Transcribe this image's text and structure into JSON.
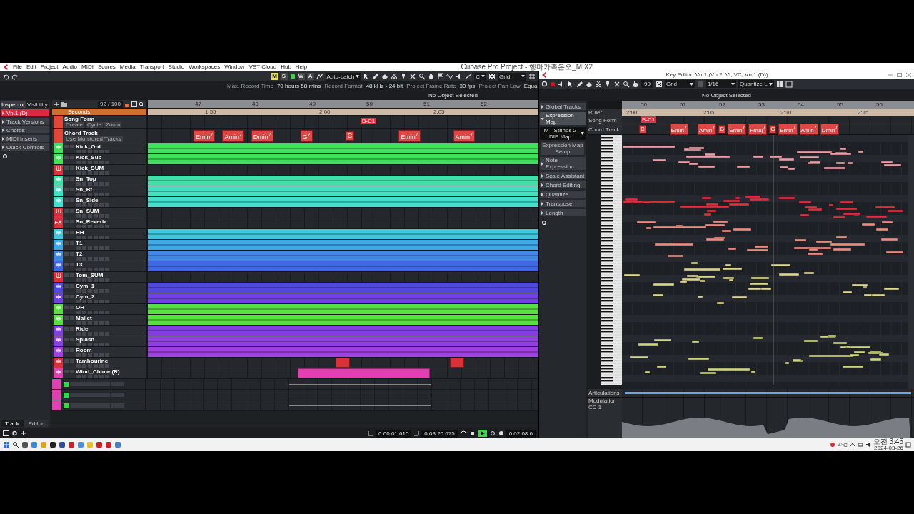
{
  "menu": [
    "File",
    "Edit",
    "Project",
    "Audio",
    "MIDI",
    "Scores",
    "Media",
    "Transport",
    "Studio",
    "Workspaces",
    "Window",
    "VST Cloud",
    "Hub",
    "Help"
  ],
  "window_title": "Cubase Pro Project - 행마가족은오_MIX2",
  "toolbar": {
    "state_buttons": [
      {
        "label": "M",
        "on": true,
        "color": "#e6e24a"
      },
      {
        "label": "S",
        "on": false
      },
      {
        "label": "W",
        "on": false
      },
      {
        "label": "A",
        "on": false
      }
    ],
    "automation_mode": "Auto-Latch",
    "key": "C",
    "snap": "Grid"
  },
  "info": [
    {
      "label": "Max. Record Time",
      "value": "70 hours 58 mins"
    },
    {
      "label": "Record Format",
      "value": "48 kHz - 24 bit"
    },
    {
      "label": "Project Frame Rate",
      "value": "30 fps"
    },
    {
      "label": "Project Pan Law",
      "value": "Equa"
    }
  ],
  "status": "No Object Selected",
  "inspector": {
    "tabs": [
      {
        "label": "Inspector",
        "selected": true
      },
      {
        "label": "Visibility",
        "selected": false
      }
    ],
    "sections": [
      {
        "label": "Vn.1 (D)",
        "kind": "track"
      },
      {
        "label": "Track Versions",
        "kind": "section"
      },
      {
        "label": "Chords",
        "kind": "section"
      },
      {
        "label": "MIDI Inserts",
        "kind": "section"
      },
      {
        "label": "Quick Controls",
        "kind": "section"
      }
    ],
    "bottom_tabs": [
      {
        "label": "Track",
        "selected": true
      },
      {
        "label": "Editor",
        "selected": false
      }
    ]
  },
  "track_count": "92 / 100",
  "ruler": {
    "bars": [
      "47",
      "48",
      "49",
      "50",
      "51",
      "52"
    ],
    "times": [
      "1:55",
      "2:00",
      "2:05"
    ]
  },
  "ruler_track": {
    "name": "Seconds"
  },
  "song_form": {
    "name": "Song Form",
    "buttons": [
      "Create",
      "Cycle",
      "Zoom"
    ],
    "marker": "B-C1"
  },
  "chord_track": {
    "name": "Chord Track",
    "option": "Use Monitored Tracks",
    "chords": [
      "Emin$^{7}$",
      "Amin$^{7}$",
      "Dmin$^{7}$",
      "G$^{7}$",
      "C",
      "Emin$^{7}$",
      "Amin$^{7}$"
    ]
  },
  "tracks": [
    {
      "name": "Kick_Out",
      "kind": "audio",
      "color": "#3fe05a",
      "clip": {
        "kind": "full"
      }
    },
    {
      "name": "Kick_Sub",
      "kind": "audio",
      "color": "#3fe05a",
      "clip": {
        "kind": "full"
      }
    },
    {
      "name": "Kick_SUM",
      "kind": "group",
      "color": "#d9303a"
    },
    {
      "name": "Sn_Top",
      "kind": "audio",
      "color": "#42e0a8",
      "clip": {
        "kind": "full"
      }
    },
    {
      "name": "Sn_Bt",
      "kind": "audio",
      "color": "#40e0c0",
      "clip": {
        "kind": "full"
      }
    },
    {
      "name": "Sn_Side",
      "kind": "audio",
      "color": "#40e0cc",
      "clip": {
        "kind": "full"
      }
    },
    {
      "name": "Sn_SUM",
      "kind": "group",
      "color": "#d9303a"
    },
    {
      "name": "Sn_Reverb",
      "kind": "fx",
      "badge": "FX",
      "color": "#d9303a"
    },
    {
      "name": "HH",
      "kind": "audio",
      "color": "#40c8dc",
      "clip": {
        "kind": "full"
      }
    },
    {
      "name": "T1",
      "kind": "audio",
      "color": "#40a8e4",
      "clip": {
        "kind": "full"
      }
    },
    {
      "name": "T2",
      "kind": "audio",
      "color": "#4088e4",
      "clip": {
        "kind": "full"
      }
    },
    {
      "name": "T3",
      "kind": "audio",
      "color": "#4068e4",
      "clip": {
        "kind": "full"
      }
    },
    {
      "name": "Tom_SUM",
      "kind": "group",
      "color": "#d9303a"
    },
    {
      "name": "Cym_1",
      "kind": "audio",
      "color": "#5048e0",
      "clip": {
        "kind": "full"
      }
    },
    {
      "name": "Cym_2",
      "kind": "audio",
      "color": "#7040e0",
      "clip": {
        "kind": "full"
      }
    },
    {
      "name": "OH",
      "kind": "audio",
      "color": "#58e040",
      "clip": {
        "kind": "full"
      }
    },
    {
      "name": "Mallet",
      "kind": "audio",
      "color": "#58e040",
      "clip": {
        "kind": "full"
      }
    },
    {
      "name": "Ride",
      "kind": "audio",
      "color": "#8040e0",
      "clip": {
        "kind": "full"
      }
    },
    {
      "name": "Splash",
      "kind": "audio",
      "color": "#9040e0",
      "clip": {
        "kind": "full"
      }
    },
    {
      "name": "Room",
      "kind": "audio",
      "color": "#a040e0",
      "clip": {
        "kind": "full"
      }
    },
    {
      "name": "Tambourine",
      "kind": "audio",
      "color": "#d9303a",
      "clip": {
        "kind": "events"
      }
    },
    {
      "name": "Wind_Chime (R)",
      "kind": "audio",
      "color": "#e040b0",
      "clip": {
        "kind": "part"
      }
    }
  ],
  "automation_lanes": [
    {
      "on": true
    },
    {
      "on": true
    },
    {
      "on": true
    }
  ],
  "transport": {
    "left": "0:00:01.610",
    "right": "0:03:20.675",
    "playing": true,
    "time": "0:02:08.6"
  },
  "key_editor": {
    "title": "Key Editor: Vn.1 (Vn.2, Vl, VC, Vn.1 (D))",
    "velocity": "99",
    "snap": "Grid",
    "quantize": "1/16",
    "length": "Quantize L",
    "status": "No Object Selected",
    "panel": [
      {
        "label": "Global Tracks",
        "expanded": false
      },
      {
        "label": "Expression Map",
        "expanded": true,
        "dropdown": "M - Strings 2 DIP Map",
        "button": "Expression Map Setup"
      },
      {
        "label": "Note Expression",
        "expanded": false
      },
      {
        "label": "Scale Assistant",
        "expanded": false
      },
      {
        "label": "Chord Editing",
        "expanded": false
      },
      {
        "label": "Quantize",
        "expanded": false
      },
      {
        "label": "Transpose",
        "expanded": false
      },
      {
        "label": "Length",
        "expanded": false
      }
    ],
    "ruler_bars": [
      "50",
      "51",
      "52",
      "53",
      "54",
      "55",
      "56"
    ],
    "ruler_times": [
      "2:00",
      "2:05",
      "2:10",
      "2:15"
    ],
    "row_labels": [
      "Ruler",
      "Song Form",
      "Chord Track"
    ],
    "song_marker": "B-C1",
    "chords": [
      "C",
      "Emin$^{7}$",
      "Amin$^{7}$",
      "G",
      "Emin$^{7}$",
      "Fmaj$^{7}$",
      "G",
      "Emin$^{7}$",
      "Amin$^{7}$",
      "Dmin$^{7}$"
    ],
    "lanes": [
      "Articulations",
      "Modulation",
      "CC 1"
    ]
  },
  "taskbar": {
    "weather": "4°C",
    "time": "오전 3:45",
    "date": "2024-03-26"
  }
}
